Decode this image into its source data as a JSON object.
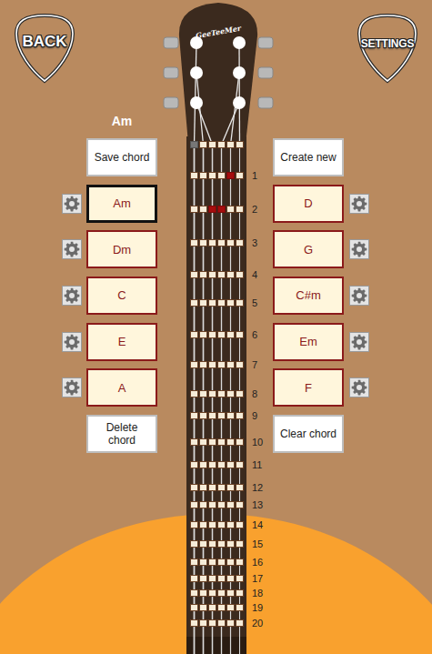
{
  "header": {
    "back": "BACK",
    "settings": "SETTINGS"
  },
  "headstock": {
    "logo": "GeeTeeMer"
  },
  "current_chord": "Am",
  "actions": {
    "save": "Save chord",
    "create": "Create new",
    "delete": "Delete chord",
    "clear": "Clear chord"
  },
  "chords_left": [
    {
      "name": "Am",
      "selected": true
    },
    {
      "name": "Dm",
      "selected": false
    },
    {
      "name": "C",
      "selected": false
    },
    {
      "name": "E",
      "selected": false
    },
    {
      "name": "A",
      "selected": false
    }
  ],
  "chords_right": [
    {
      "name": "D",
      "selected": false
    },
    {
      "name": "G",
      "selected": false
    },
    {
      "name": "C#m",
      "selected": false
    },
    {
      "name": "Em",
      "selected": false
    },
    {
      "name": "F",
      "selected": false
    }
  ],
  "open_strings": [
    {
      "muted": true
    },
    {
      "muted": false
    },
    {
      "muted": false
    },
    {
      "muted": false
    },
    {
      "muted": false
    },
    {
      "muted": false
    }
  ],
  "frets": [
    {
      "number": "1",
      "pressed": [
        false,
        false,
        false,
        false,
        true,
        false
      ]
    },
    {
      "number": "2",
      "pressed": [
        false,
        false,
        true,
        true,
        false,
        false
      ]
    },
    {
      "number": "3",
      "pressed": [
        false,
        false,
        false,
        false,
        false,
        false
      ]
    },
    {
      "number": "4",
      "pressed": [
        false,
        false,
        false,
        false,
        false,
        false
      ]
    },
    {
      "number": "5",
      "pressed": [
        false,
        false,
        false,
        false,
        false,
        false
      ]
    },
    {
      "number": "6",
      "pressed": [
        false,
        false,
        false,
        false,
        false,
        false
      ]
    },
    {
      "number": "7",
      "pressed": [
        false,
        false,
        false,
        false,
        false,
        false
      ]
    },
    {
      "number": "8",
      "pressed": [
        false,
        false,
        false,
        false,
        false,
        false
      ]
    },
    {
      "number": "9",
      "pressed": [
        false,
        false,
        false,
        false,
        false,
        false
      ]
    },
    {
      "number": "10",
      "pressed": [
        false,
        false,
        false,
        false,
        false,
        false
      ]
    },
    {
      "number": "11",
      "pressed": [
        false,
        false,
        false,
        false,
        false,
        false
      ]
    },
    {
      "number": "12",
      "pressed": [
        false,
        false,
        false,
        false,
        false,
        false
      ]
    },
    {
      "number": "13",
      "pressed": [
        false,
        false,
        false,
        false,
        false,
        false
      ]
    },
    {
      "number": "14",
      "pressed": [
        false,
        false,
        false,
        false,
        false,
        false
      ]
    },
    {
      "number": "15",
      "pressed": [
        false,
        false,
        false,
        false,
        false,
        false
      ]
    },
    {
      "number": "16",
      "pressed": [
        false,
        false,
        false,
        false,
        false,
        false
      ]
    },
    {
      "number": "17",
      "pressed": [
        false,
        false,
        false,
        false,
        false,
        false
      ]
    },
    {
      "number": "18",
      "pressed": [
        false,
        false,
        false,
        false,
        false,
        false
      ]
    },
    {
      "number": "19",
      "pressed": [
        false,
        false,
        false,
        false,
        false,
        false
      ]
    },
    {
      "number": "20",
      "pressed": [
        false,
        false,
        false,
        false,
        false,
        false
      ]
    }
  ]
}
